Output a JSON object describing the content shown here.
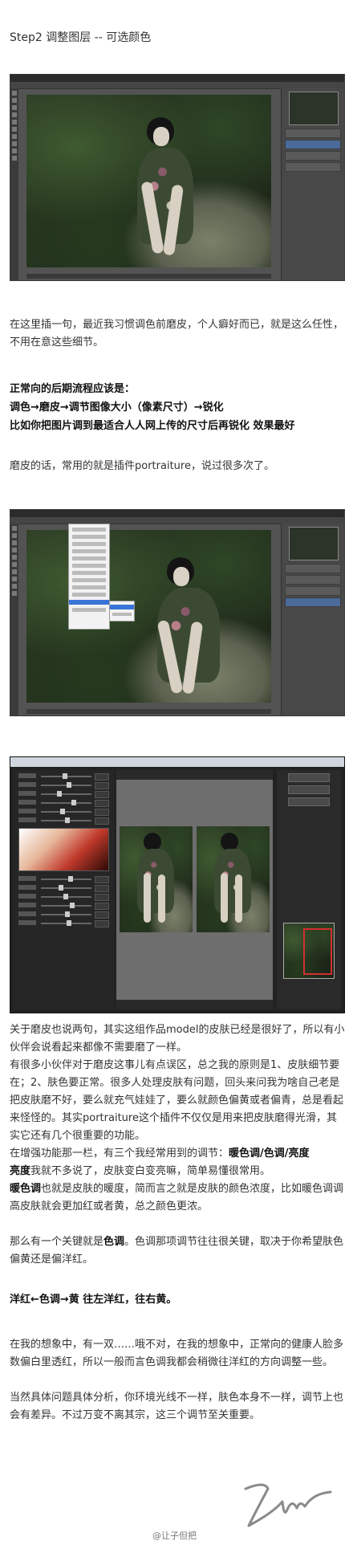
{
  "step_title": "Step2  调整图层 -- 可选颜色",
  "para1": "在这里插一句，最近我习惯调色前磨皮，个人癖好而已，就是这么任性，不用在意这些细节。",
  "workflow_heading": "正常向的后期流程应该是：",
  "workflow_line1": "调色→磨皮→调节图像大小（像素尺寸）→锐化",
  "workflow_line2": "比如你把图片调到最适合人人网上传的尺寸后再锐化 效果最好",
  "para2": "磨皮的话，常用的就是插件portraiture，说过很多次了。",
  "para3": "关于磨皮也说两句，其实这组作品model的皮肤已经是很好了，所以有小伙伴会说看起来都像不需要磨了一样。",
  "para4": "有很多小伙伴对于磨皮这事儿有点误区，总之我的原则是1、皮肤细节要在；2、肤色要正常。很多人处理皮肤有问题，回头来问我为啥自己老是把皮肤磨不好，要么就充气娃娃了，要么就颜色偏黄或者偏青，总是看起来怪怪的。其实portraiture这个插件不仅仅是用来把皮肤磨得光滑，其实它还有几个很重要的功能。",
  "para5_prefix": "在增强功能那一栏，有三个我经常用到的调节：",
  "para5_bold": "暖色调/色调/亮度",
  "para5_mid": "亮度",
  "para5_suffix": "我就不多说了，皮肤变白变亮嘛，简单易懂很常用。",
  "para6_bold": "暖色调",
  "para6_text": "也就是皮肤的暖度，简而言之就是皮肤的颜色浓度，比如暖色调调高皮肤就会更加红或者黄，总之颜色更浓。",
  "para7_prefix": "那么有一个关键就是",
  "para7_bold": "色调",
  "para7_suffix": "。色调那项调节往往很关键，取决于你希望肤色偏黄还是偏洋红。",
  "hue_rule": "洋红←色调→黄 往左洋红，往右黄。",
  "para8": "在我的想象中，有一双……哦不对，在我的想象中，正常向的健康人脸多数偏白里透红，所以一般而言色调我都会稍微往洋红的方向调整一些。",
  "para9": "当然具体问题具体分析，你环境光线不一样，肤色本身不一样，调节上也会有差异。不过万变不离其宗，这三个调节至关重要。",
  "watermark": "@让子但把",
  "colors": {
    "accent_red": "#c0392b",
    "ps_gray": "#535353"
  },
  "icons": [
    "photoshop-window",
    "portraiture-plugin-window",
    "signature"
  ]
}
